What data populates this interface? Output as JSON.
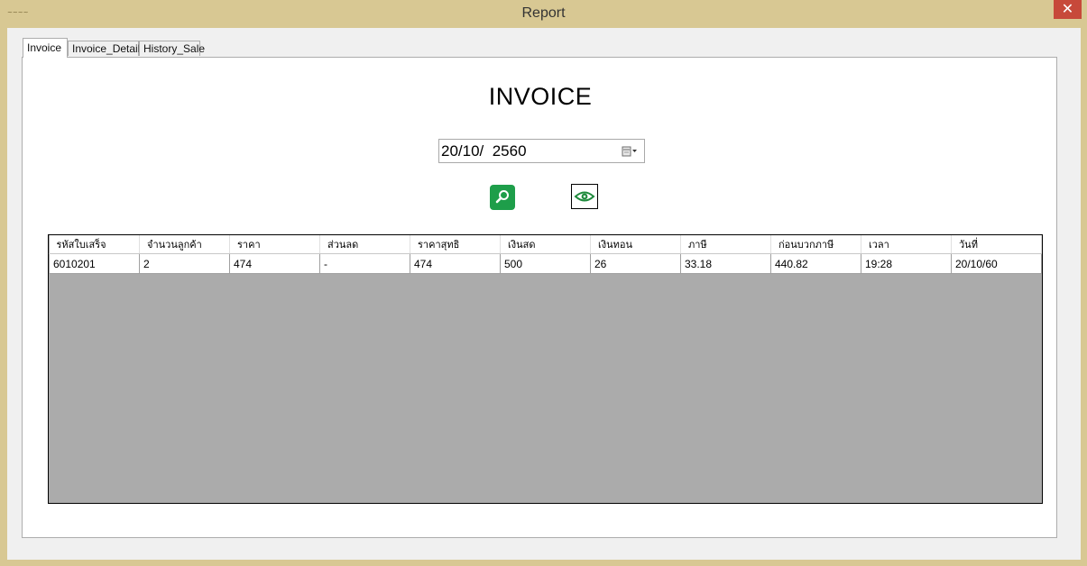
{
  "window": {
    "title": "Report",
    "close_glyph": "✕",
    "accent": "#d8c893",
    "close_color": "#c7493a"
  },
  "tabs": [
    {
      "label": "Invoice",
      "active": true
    },
    {
      "label": "Invoice_Detail",
      "active": false
    },
    {
      "label": "History_Sale",
      "active": false
    }
  ],
  "main": {
    "heading": "INVOICE",
    "date_value": "20/10/  2560",
    "date_icon": "calendar-dropdown-icon",
    "search_icon": "magnifier-icon",
    "search_color": "#1e9e4a",
    "view_icon": "eye-icon"
  },
  "grid": {
    "columns": [
      "รหัสใบเสร็จ",
      "จำนวนลูกค้า",
      "ราคา",
      "ส่วนลด",
      "ราคาสุทธิ",
      "เงินสด",
      "เงินทอน",
      "ภาษี",
      "ก่อนบวกภาษี",
      "เวลา",
      "วันที่"
    ],
    "rows": [
      [
        "6010201",
        "2",
        "474",
        "-",
        "474",
        "500",
        "26",
        "33.18",
        "440.82",
        "19:28",
        "20/10/60"
      ]
    ],
    "empty_color": "#ababab"
  }
}
